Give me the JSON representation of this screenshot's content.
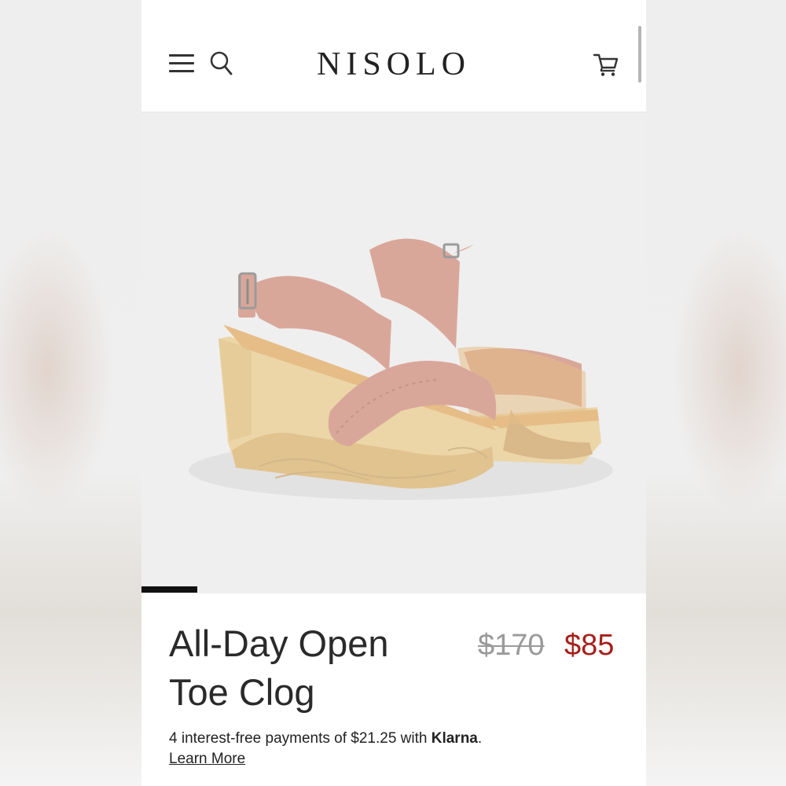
{
  "header": {
    "logo": "NISOLO",
    "menu_icon": "hamburger-menu-icon",
    "search_icon": "search-icon",
    "cart_icon": "shopping-cart-icon"
  },
  "product": {
    "image": "pink-open-toe-clog-sandals-photo",
    "title_line1": "All-Day Open",
    "title_line2": "Toe Clog",
    "price_original": "$170",
    "price_sale": "$85",
    "installments_text": "4 interest-free payments of $21.25 with ",
    "installments_provider": "Klarna",
    "installments_suffix": ".",
    "learn_more": "Learn More"
  },
  "colors": {
    "sale_price": "#a5201c",
    "strap": "#d9a79a",
    "wood": "#ecd6a8",
    "footbed": "#e6bd86"
  }
}
